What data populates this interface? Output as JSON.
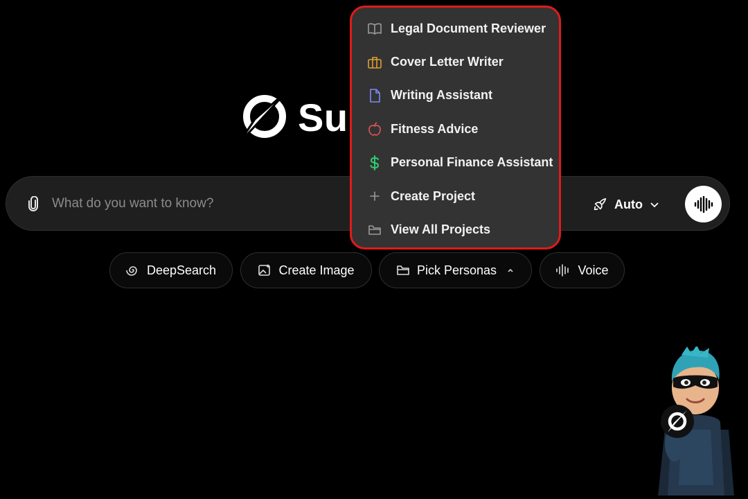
{
  "brand": {
    "name": "Su"
  },
  "search": {
    "placeholder": "What do you want to know?",
    "model_label": "Auto"
  },
  "pills": [
    {
      "label": "DeepSearch",
      "icon": "swirl-icon"
    },
    {
      "label": "Create Image",
      "icon": "image-sparkle-icon"
    },
    {
      "label": "Pick Personas",
      "icon": "folder-icon"
    },
    {
      "label": "Voice",
      "icon": "waveform-icon"
    }
  ],
  "personas_menu": {
    "items": [
      {
        "label": "Legal Document Reviewer",
        "icon": "book-icon",
        "color": "#9a9a9a"
      },
      {
        "label": "Cover Letter Writer",
        "icon": "briefcase-icon",
        "color": "#e0a030"
      },
      {
        "label": "Writing Assistant",
        "icon": "document-icon",
        "color": "#7b8cf0"
      },
      {
        "label": "Fitness Advice",
        "icon": "apple-icon",
        "color": "#e25555"
      },
      {
        "label": "Personal Finance Assistant",
        "icon": "dollar-icon",
        "color": "#2ecc71"
      },
      {
        "label": "Create Project",
        "icon": "plus-icon",
        "color": "#9a9a9a"
      },
      {
        "label": "View All Projects",
        "icon": "folder-icon",
        "color": "#9a9a9a"
      }
    ],
    "highlight_color": "#e01b1b"
  }
}
